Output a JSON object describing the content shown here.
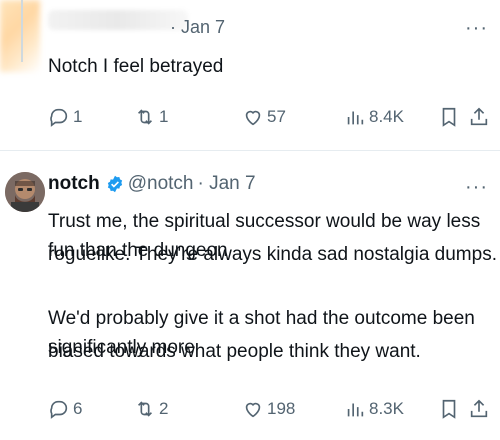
{
  "tweets": [
    {
      "meta": "· Jan 7",
      "more": "···",
      "text": "Notch I feel betrayed",
      "actions": {
        "replies": "1",
        "reposts": "1",
        "likes": "57",
        "views": "8.4K"
      }
    },
    {
      "name": "notch",
      "handle": "@notch",
      "date": "· Jan 7",
      "more": "···",
      "text_lines": [
        "Trust me, the spiritual successor would be way less fun than the dungeon",
        "roguelike. They're always kinda sad nostalgia dumps.",
        "We'd probably give it a shot had the outcome been significantly more",
        "biased towards what people think they want."
      ],
      "actions": {
        "replies": "6",
        "reposts": "2",
        "likes": "198",
        "views": "8.3K"
      }
    }
  ],
  "colors": {
    "muted": "#536471",
    "text": "#0f1419",
    "verified": "#1d9bf0",
    "divider": "#e6ecf0"
  },
  "icons": [
    "reply-icon",
    "repost-icon",
    "like-icon",
    "views-icon",
    "bookmark-icon",
    "share-icon",
    "verified-badge-icon",
    "more-icon"
  ]
}
